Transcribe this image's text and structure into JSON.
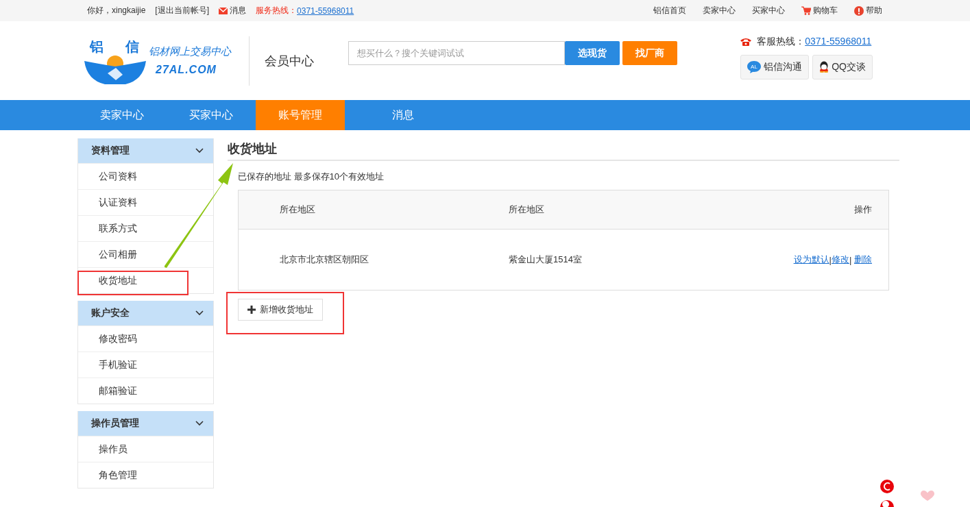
{
  "top_bar": {
    "greeting": "你好，xingkaijie",
    "logout_link": "[退出当前帐号]",
    "messages_link": "消息",
    "hotline_label": "服务热线：",
    "hotline_number": "0371-55968011",
    "links": [
      "铝信首页",
      "卖家中心",
      "买家中心"
    ],
    "cart_link": "购物车",
    "help_link": "帮助"
  },
  "header": {
    "logo_chars": [
      "铝",
      "信"
    ],
    "logo_tagline": "铝材网上交易中心",
    "logo_domain": "27AL.COM",
    "section_title": "会员中心",
    "search": {
      "placeholder": "想买什么？搜个关键词试试"
    },
    "search_buttons": [
      {
        "kind": "primary",
        "label": "选现货"
      },
      {
        "kind": "accent",
        "label": "找厂商"
      }
    ],
    "service_label": "客服热线：",
    "service_number": "0371-55968011",
    "chat_buttons": [
      {
        "kind": "al",
        "label": "铝信沟通",
        "badge": "AL"
      },
      {
        "kind": "qq",
        "label": "QQ交谈"
      }
    ]
  },
  "nav": [
    {
      "label": "卖家中心",
      "selected": false
    },
    {
      "label": "买家中心",
      "selected": false
    },
    {
      "label": "账号管理",
      "selected": true
    },
    {
      "label": "消息",
      "selected": false
    }
  ],
  "sidebar": [
    {
      "title": "资料管理",
      "expanded": true,
      "items": [
        "公司资料",
        "认证资料",
        "联系方式",
        "公司相册",
        "收货地址"
      ]
    },
    {
      "title": "账户安全",
      "expanded": true,
      "items": [
        "修改密码",
        "手机验证",
        "邮箱验证"
      ]
    },
    {
      "title": "操作员管理",
      "expanded": true,
      "items": [
        "操作员",
        "角色管理"
      ]
    }
  ],
  "content": {
    "title": "收货地址",
    "note": "已保存的地址 最多保存10个有效地址",
    "table": {
      "columns": [
        "所在地区",
        "所在地区",
        "操作"
      ],
      "rows": [
        {
          "region": "北京市北京辖区朝阳区",
          "address": "紫金山大厦1514室",
          "actions": [
            "设为默认",
            "修改",
            "删除"
          ]
        }
      ],
      "action_separator": "|"
    },
    "add_button": "新增收货地址"
  }
}
